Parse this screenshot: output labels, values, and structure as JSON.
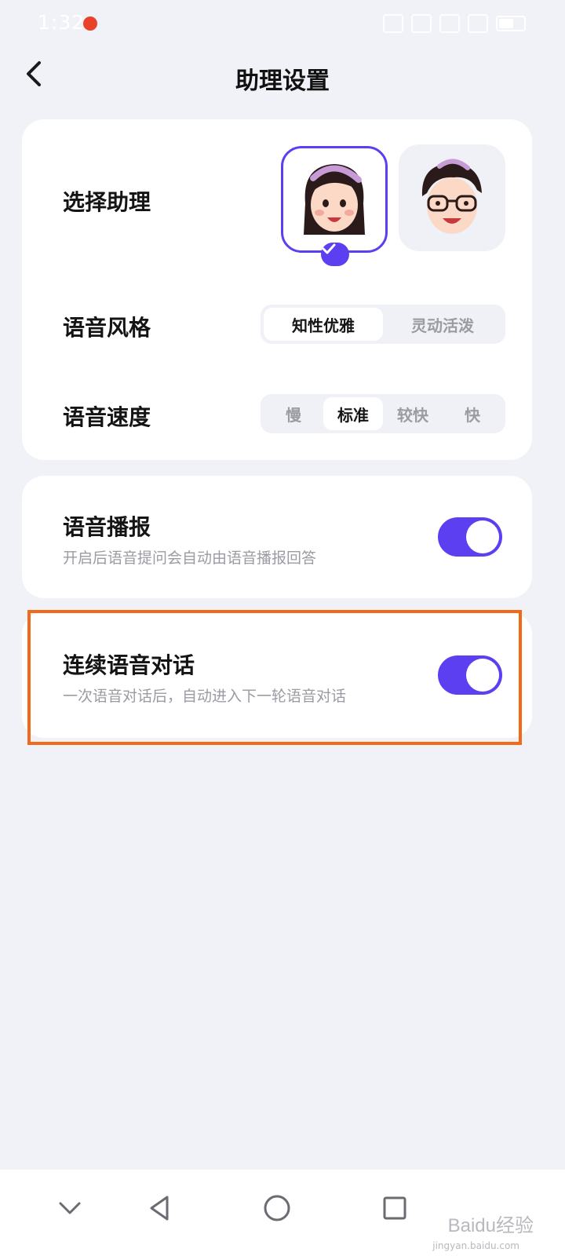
{
  "status_bar": {
    "time": "1:32",
    "icons": [
      "alarm-icon",
      "wifi-icon",
      "signal-icon",
      "signal-icon",
      "battery-icon"
    ]
  },
  "header": {
    "title": "助理设置",
    "back_icon": "back-chevron-icon"
  },
  "assistant": {
    "label": "选择助理",
    "options": [
      "female-avatar",
      "male-avatar"
    ],
    "selected": "female-avatar"
  },
  "voice_style": {
    "label": "语音风格",
    "options": [
      "知性优雅",
      "灵动活泼"
    ],
    "selected": "知性优雅"
  },
  "voice_speed": {
    "label": "语音速度",
    "options": [
      "慢",
      "标准",
      "较快",
      "快"
    ],
    "selected": "标准"
  },
  "voice_broadcast": {
    "title": "语音播报",
    "description": "开启后语音提问会自动由语音播报回答",
    "enabled": true
  },
  "continuous_dialog": {
    "title": "连续语音对话",
    "description": "一次语音对话后，自动进入下一轮语音对话",
    "enabled": true
  },
  "nav_bar": {
    "icons": [
      "chevron-down-icon",
      "back-triangle-icon",
      "home-circle-icon",
      "recents-square-icon"
    ]
  },
  "watermark": {
    "main": "Baidu经验",
    "sub": "jingyan.baidu.com"
  },
  "colors": {
    "accent": "#5b3ff0",
    "highlight": "#f06a1a",
    "background": "#f1f2f7"
  }
}
